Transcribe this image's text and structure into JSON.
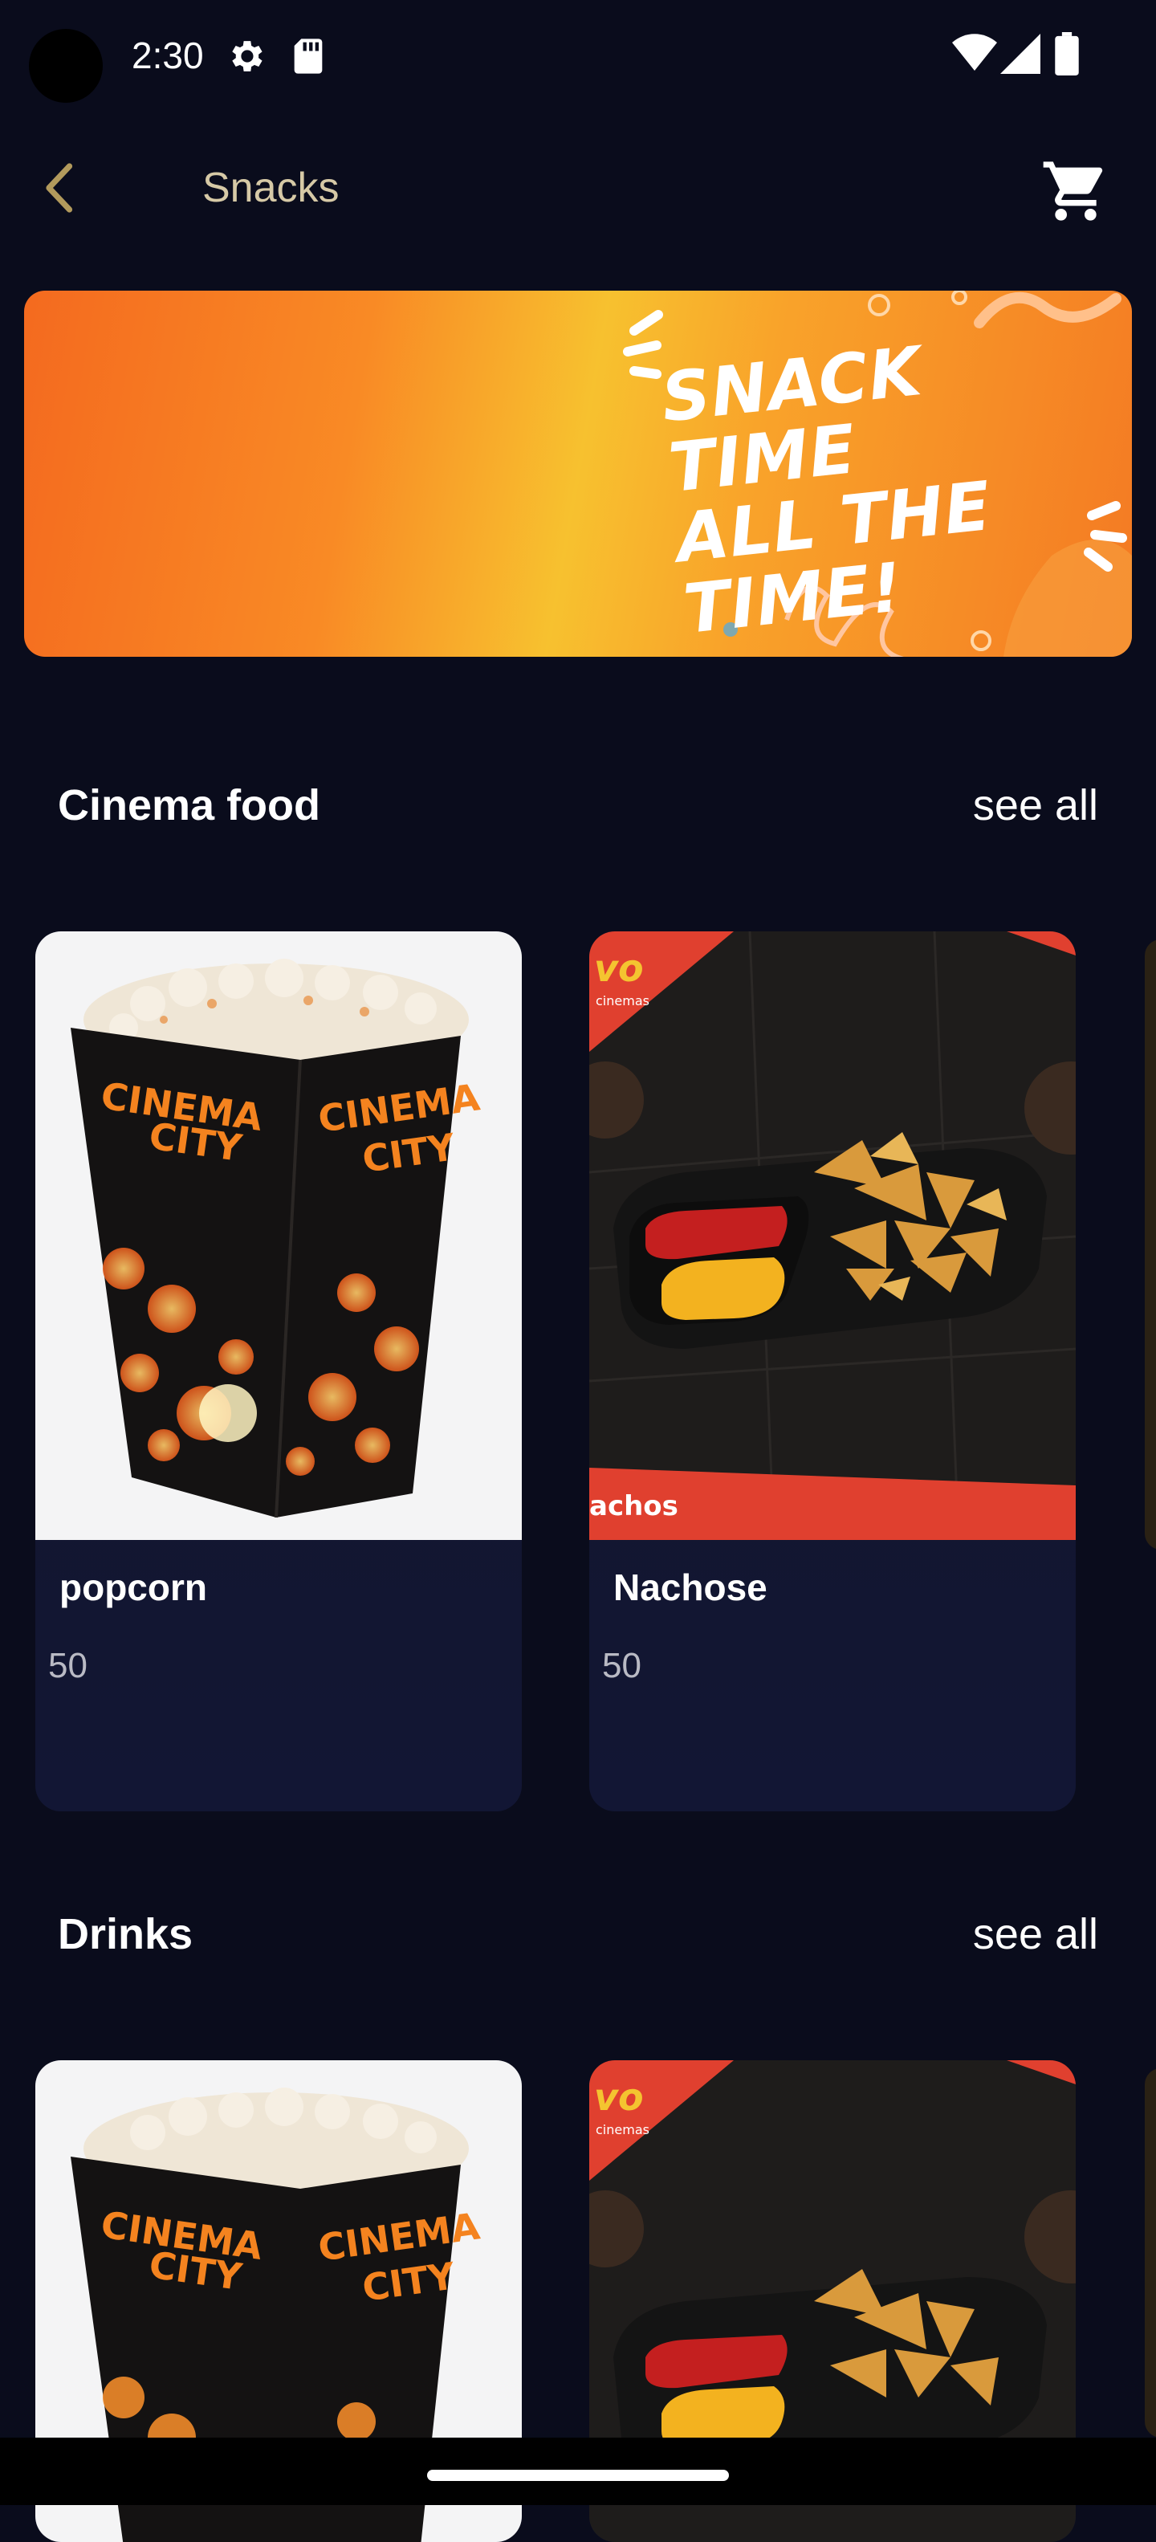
{
  "status_bar": {
    "time": "2:30",
    "icons": [
      "settings-gear-icon",
      "sd-card-icon",
      "wifi-icon",
      "signal-icon",
      "battery-icon"
    ]
  },
  "header": {
    "title": "Snacks",
    "back_icon": "chevron-left-icon",
    "cart_icon": "shopping-cart-icon"
  },
  "banner": {
    "line1": "SNACK TIME",
    "line2": "ALL THE TIME!"
  },
  "sections": [
    {
      "title": "Cinema food",
      "see_all": "see all",
      "items": [
        {
          "name": "popcorn",
          "price": "50",
          "image_label_1": "CINEMA",
          "image_label_2": "CITY"
        },
        {
          "name": "Nachose",
          "price": "50",
          "image_label_1": "achos",
          "image_label_2": "cinemas"
        }
      ]
    },
    {
      "title": "Drinks",
      "see_all": "see all",
      "items": [
        {
          "name": "",
          "price": "",
          "image_label_1": "CINEMA",
          "image_label_2": "CITY"
        },
        {
          "name": "",
          "price": "",
          "image_label_1": "",
          "image_label_2": "cinemas"
        }
      ]
    }
  ],
  "colors": {
    "background": "#0a0c1c",
    "title_accent": "#d6c9a6",
    "card_bg": "#14162a",
    "banner_orange": "#f47a23"
  }
}
